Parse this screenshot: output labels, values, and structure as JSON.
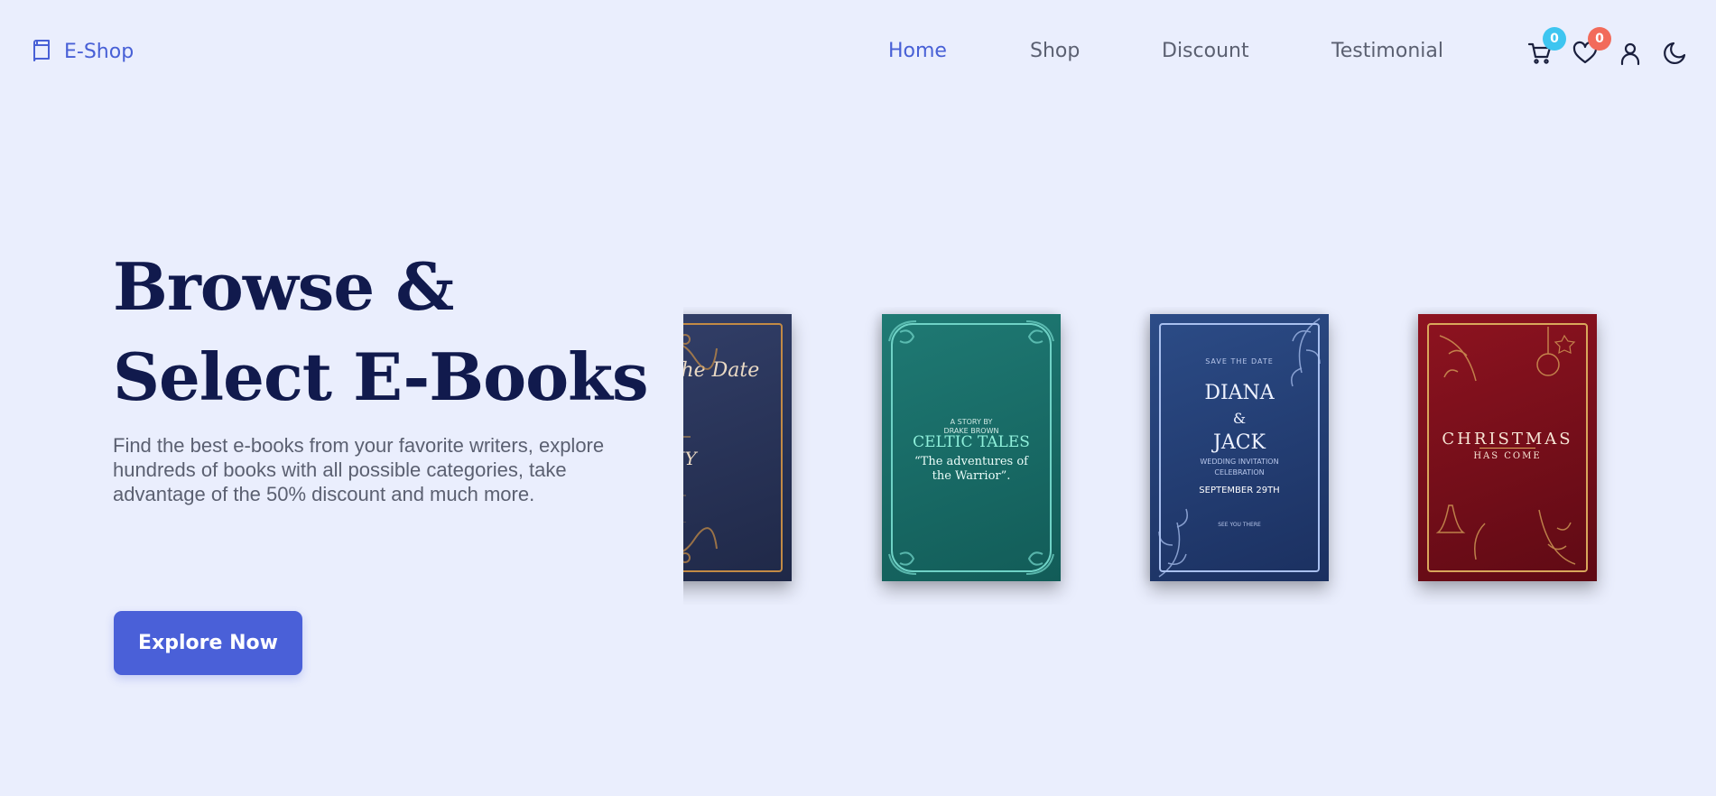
{
  "brand": {
    "name": "E-Shop",
    "icon": "book-icon",
    "color": "#4860d6"
  },
  "nav": [
    {
      "label": "Home",
      "active": true
    },
    {
      "label": "Shop",
      "active": false
    },
    {
      "label": "Discount",
      "active": false
    },
    {
      "label": "Testimonial",
      "active": false
    }
  ],
  "actions": {
    "cart": {
      "icon": "cart-icon",
      "count": "0",
      "badge_color": "#3ec5f0"
    },
    "wishlist": {
      "icon": "heart-icon",
      "count": "0",
      "badge_color": "#f26b5b"
    },
    "account": {
      "icon": "user-icon"
    },
    "theme": {
      "icon": "moon-icon"
    }
  },
  "hero": {
    "title_line1": "Browse &",
    "title_line2": "Select E-Books",
    "description": "Find the best e-books from your favorite writers, explore hundreds of books with all possible categories, take advantage of the 50% discount and much more.",
    "cta_label": "Explore Now",
    "cta_color": "#4a60d8"
  },
  "books": [
    {
      "cover_script": "Save the Date",
      "cover_names": "& TONY"
    },
    {
      "cover_small": "A STORY BY",
      "cover_author": "DRAKE BROWN",
      "cover_title": "CELTIC TALES",
      "cover_subtitle": "“The adventures of the Warrior”."
    },
    {
      "cover_top": "SAVE THE DATE",
      "cover_name1": "DIANA",
      "cover_amp": "&",
      "cover_name2": "JACK",
      "cover_inv1": "WEDDING INVITATION",
      "cover_inv2": "CELEBRATION",
      "cover_date": "SEPTEMBER 29TH",
      "cover_see": "SEE YOU THERE"
    },
    {
      "cover_title": "CHRISTMAS",
      "cover_subtitle": "HAS COME"
    }
  ]
}
